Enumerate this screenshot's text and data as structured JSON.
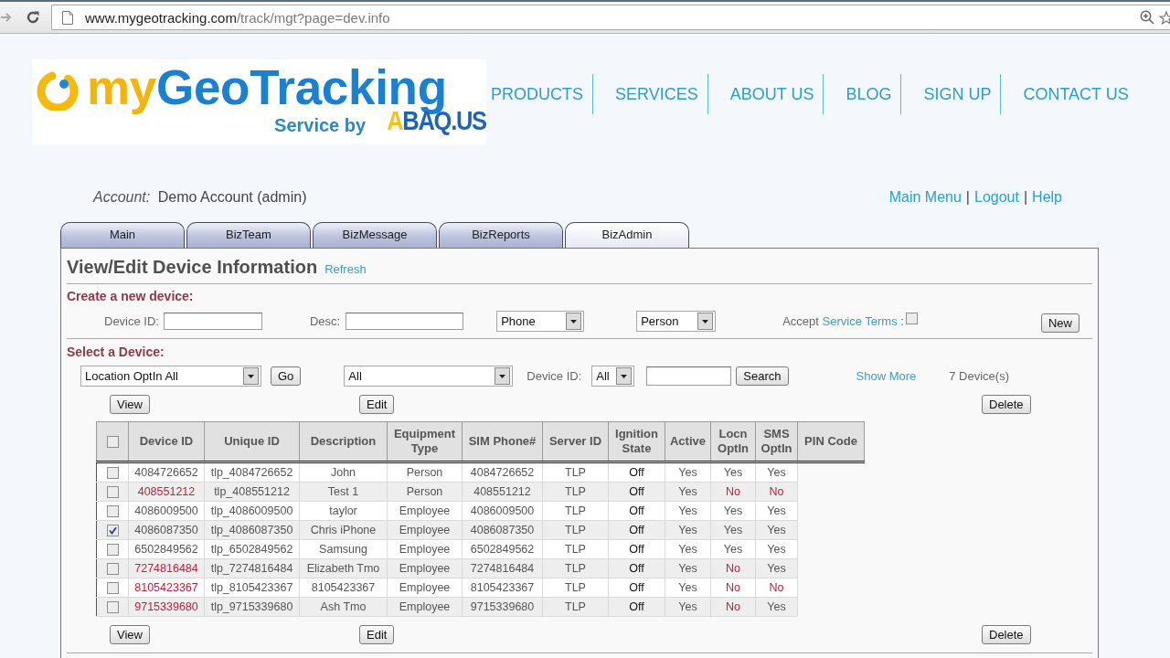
{
  "browser": {
    "url_host": "www.mygeotracking.com",
    "url_path": "/track/mgt?page=dev.info"
  },
  "logo": {
    "prefix": "my",
    "name": "GeoTracking",
    "tagline": "Service by",
    "brand": "ABAQ.US"
  },
  "nav": [
    "PRODUCTS",
    "SERVICES",
    "ABOUT US",
    "BLOG",
    "SIGN UP",
    "CONTACT US"
  ],
  "account": {
    "label": "Account:",
    "value": "Demo Account (admin)"
  },
  "user_links": {
    "items": [
      "Main Menu",
      "Logout",
      "Help"
    ],
    "separator": "|"
  },
  "tabs": [
    {
      "label": "Main",
      "selected": false
    },
    {
      "label": "BizTeam",
      "selected": false
    },
    {
      "label": "BizMessage",
      "selected": false
    },
    {
      "label": "BizReports",
      "selected": false
    },
    {
      "label": "BizAdmin",
      "selected": true
    }
  ],
  "panel": {
    "title": "View/Edit Device Information",
    "refresh": "Refresh"
  },
  "create": {
    "heading": "Create a new device:",
    "device_id_label": "Device ID:",
    "desc_label": "Desc:",
    "type_select": "Phone",
    "category_select": "Person",
    "accept": {
      "prefix": "Accept",
      "link": "Service Terms",
      "suffix": ":",
      "checked": false
    },
    "new_button": "New"
  },
  "select": {
    "heading": "Select a Device:",
    "filter_select": "Location OptIn All",
    "go_button": "Go",
    "group_select": "All",
    "device_id_label": "Device ID:",
    "device_id_select": "All",
    "search_button": "Search",
    "show_more": "Show More",
    "count": "7 Device(s)"
  },
  "actions_top": [
    "View",
    "Edit",
    "Delete"
  ],
  "table": {
    "select_all_checked": false,
    "columns": [
      "Device ID",
      "Unique ID",
      "Description",
      "Equipment Type",
      "SIM Phone#",
      "Server ID",
      "Ignition State",
      "Active",
      "Locn OptIn",
      "SMS OptIn",
      "PIN Code"
    ],
    "rows": [
      {
        "checked": false,
        "flagged": false,
        "cells": [
          "4084726652",
          "tlp_4084726652",
          "John",
          "Person",
          "4084726652",
          "TLP",
          "Off",
          "Yes"
        ],
        "locn_optin": {
          "text": "Yes",
          "opted_in": true
        },
        "sms_optin": {
          "text": "Yes",
          "opted_in": true
        }
      },
      {
        "checked": false,
        "flagged": true,
        "cells": [
          "408551212",
          "tlp_408551212",
          "Test 1",
          "Person",
          "408551212",
          "TLP",
          "Off",
          "Yes"
        ],
        "locn_optin": {
          "text": "No",
          "opted_in": false
        },
        "sms_optin": {
          "text": "No",
          "opted_in": false
        }
      },
      {
        "checked": false,
        "flagged": false,
        "cells": [
          "4086009500",
          "tlp_4086009500",
          "taylor",
          "Employee",
          "4086009500",
          "TLP",
          "Off",
          "Yes"
        ],
        "locn_optin": {
          "text": "Yes",
          "opted_in": true
        },
        "sms_optin": {
          "text": "Yes",
          "opted_in": true
        }
      },
      {
        "checked": true,
        "flagged": false,
        "cells": [
          "4086087350",
          "tlp_4086087350",
          "Chris iPhone",
          "Employee",
          "4086087350",
          "TLP",
          "Off",
          "Yes"
        ],
        "locn_optin": {
          "text": "Yes",
          "opted_in": true
        },
        "sms_optin": {
          "text": "Yes",
          "opted_in": true
        }
      },
      {
        "checked": false,
        "flagged": false,
        "cells": [
          "6502849562",
          "tlp_6502849562",
          "Samsung",
          "Employee",
          "6502849562",
          "TLP",
          "Off",
          "Yes"
        ],
        "locn_optin": {
          "text": "Yes",
          "opted_in": true
        },
        "sms_optin": {
          "text": "Yes",
          "opted_in": true
        }
      },
      {
        "checked": false,
        "flagged": true,
        "cells": [
          "7274816484",
          "tlp_7274816484",
          "Elizabeth Tmo",
          "Employee",
          "7274816484",
          "TLP",
          "Off",
          "Yes"
        ],
        "locn_optin": {
          "text": "No",
          "opted_in": false
        },
        "sms_optin": {
          "text": "Yes",
          "opted_in": true
        }
      },
      {
        "checked": false,
        "flagged": true,
        "cells": [
          "8105423367",
          "tlp_8105423367",
          "8105423367",
          "Employee",
          "8105423367",
          "TLP",
          "Off",
          "Yes"
        ],
        "locn_optin": {
          "text": "No",
          "opted_in": false
        },
        "sms_optin": {
          "text": "No",
          "opted_in": false
        }
      },
      {
        "checked": false,
        "flagged": true,
        "cells": [
          "9715339680",
          "tlp_9715339680",
          "Ash Tmo",
          "Employee",
          "9715339680",
          "TLP",
          "Off",
          "Yes"
        ],
        "locn_optin": {
          "text": "No",
          "opted_in": false
        },
        "sms_optin": {
          "text": "Yes",
          "opted_in": true
        }
      }
    ]
  },
  "actions_bottom": [
    "View",
    "Edit",
    "Delete"
  ]
}
